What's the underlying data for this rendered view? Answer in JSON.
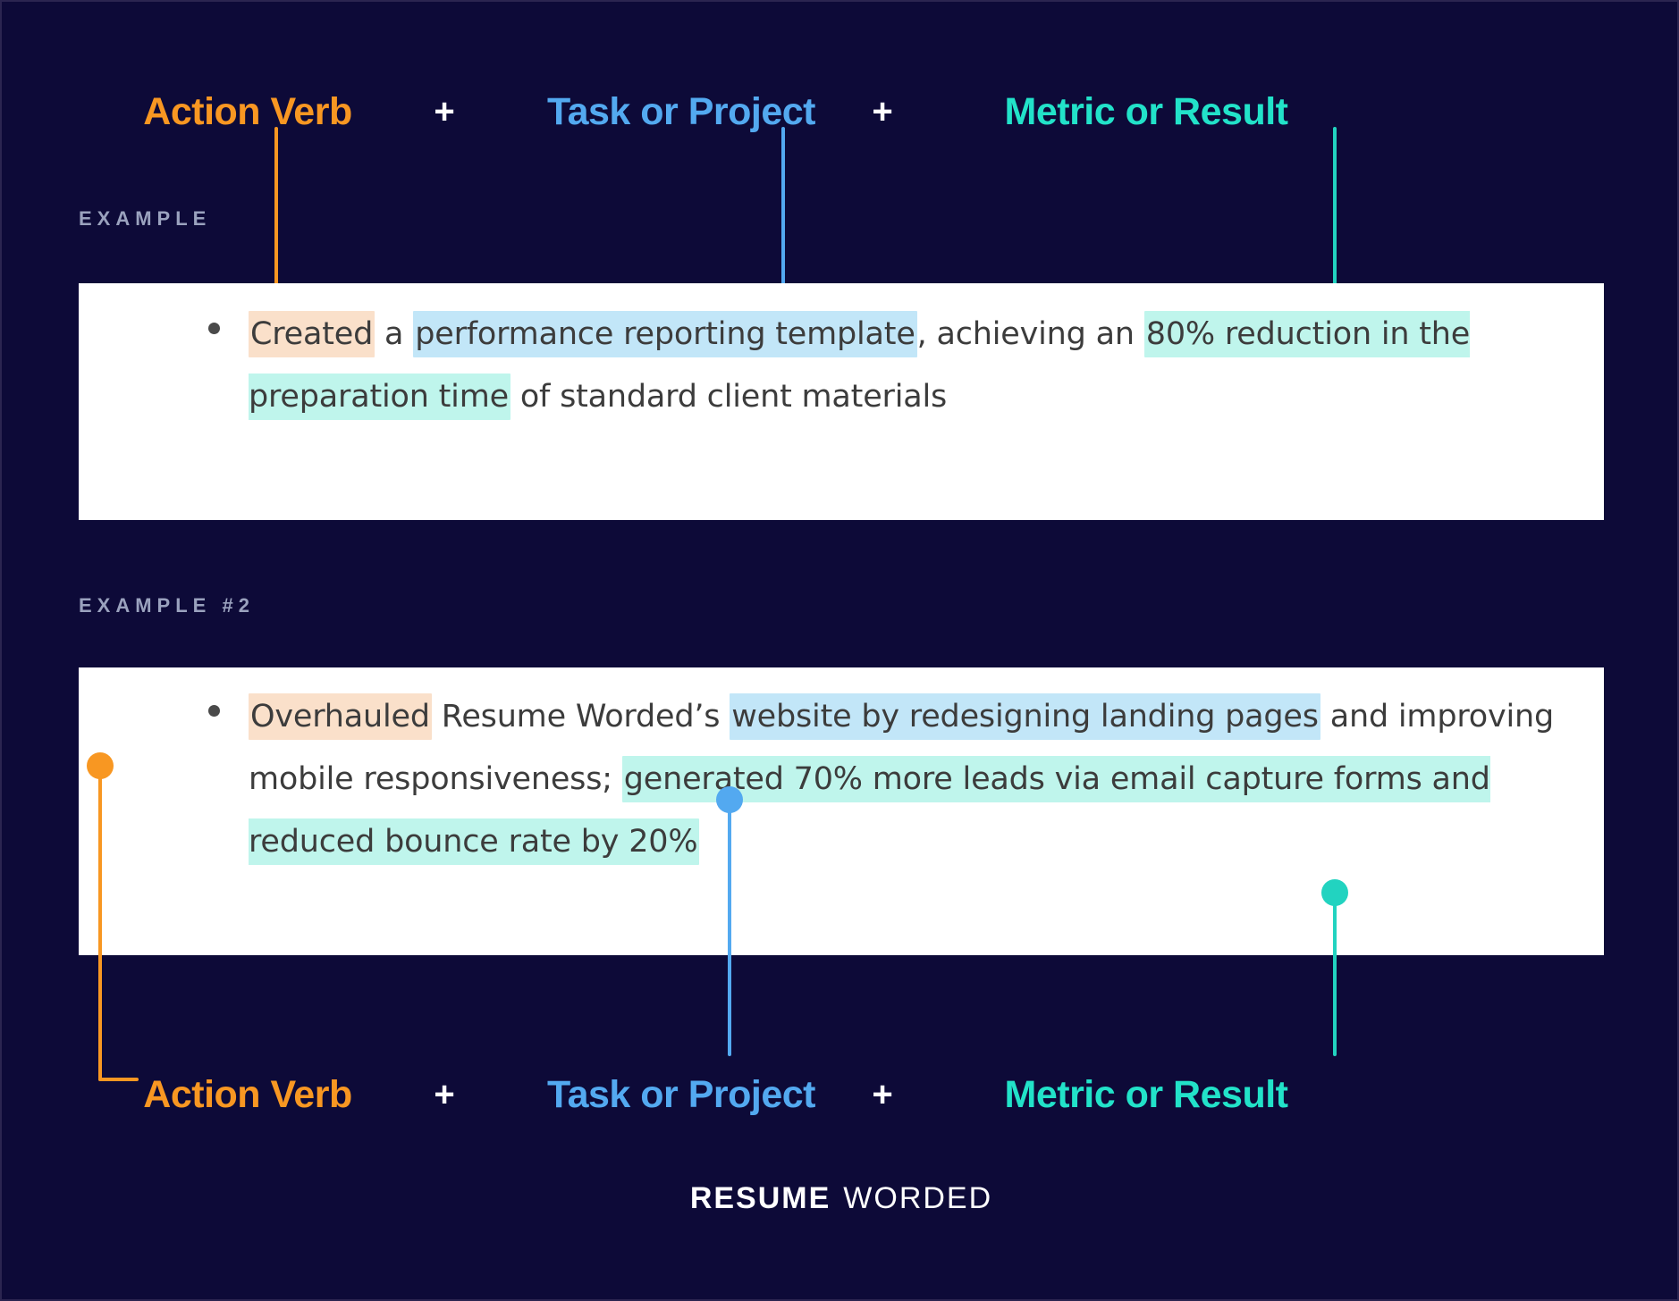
{
  "formula": {
    "top": {
      "action": "Action Verb",
      "plus1": "+",
      "task": "Task or Project",
      "plus2": "+",
      "metric": "Metric or Result"
    },
    "bottom": {
      "action": "Action Verb",
      "plus1": "+",
      "task": "Task or Project",
      "plus2": "+",
      "metric": "Metric or Result"
    }
  },
  "colors": {
    "background": "#0D0A38",
    "action_verb": "#F89722",
    "task_project": "#53A9F0",
    "metric_result": "#22E2C9",
    "highlight_verb": "#FAE0CA",
    "highlight_task": "#C2E6F8",
    "highlight_metric": "#BFF5EC",
    "card": "#FFFFFF",
    "label_text": "#9AA2BE",
    "body_text": "#3C3C3C"
  },
  "examples": [
    {
      "label": "EXAMPLE",
      "segments": [
        {
          "text": "Created",
          "highlight": "verb"
        },
        {
          "text": " a ",
          "highlight": "none"
        },
        {
          "text": "performance reporting template",
          "highlight": "task"
        },
        {
          "text": ", achieving an ",
          "highlight": "none"
        },
        {
          "text": "80% reduction in the preparation time",
          "highlight": "metric"
        },
        {
          "text": " of standard client materials",
          "highlight": "none"
        }
      ]
    },
    {
      "label": "EXAMPLE #2",
      "segments": [
        {
          "text": "Overhauled",
          "highlight": "verb"
        },
        {
          "text": " Resume Worded’s ",
          "highlight": "none"
        },
        {
          "text": "website by redesigning landing pages",
          "highlight": "task"
        },
        {
          "text": " and improving mobile responsiveness; ",
          "highlight": "none"
        },
        {
          "text": "generated 70% more leads via email capture forms and reduced bounce rate by 20%",
          "highlight": "metric"
        }
      ]
    }
  ],
  "footer": {
    "brand_bold": "RESUME",
    "brand_light": "WORDED"
  },
  "icons": {
    "bullet": "bullet-dot",
    "connector_action": "connector-line-orange",
    "connector_task": "connector-line-blue",
    "connector_metric": "connector-line-teal"
  }
}
